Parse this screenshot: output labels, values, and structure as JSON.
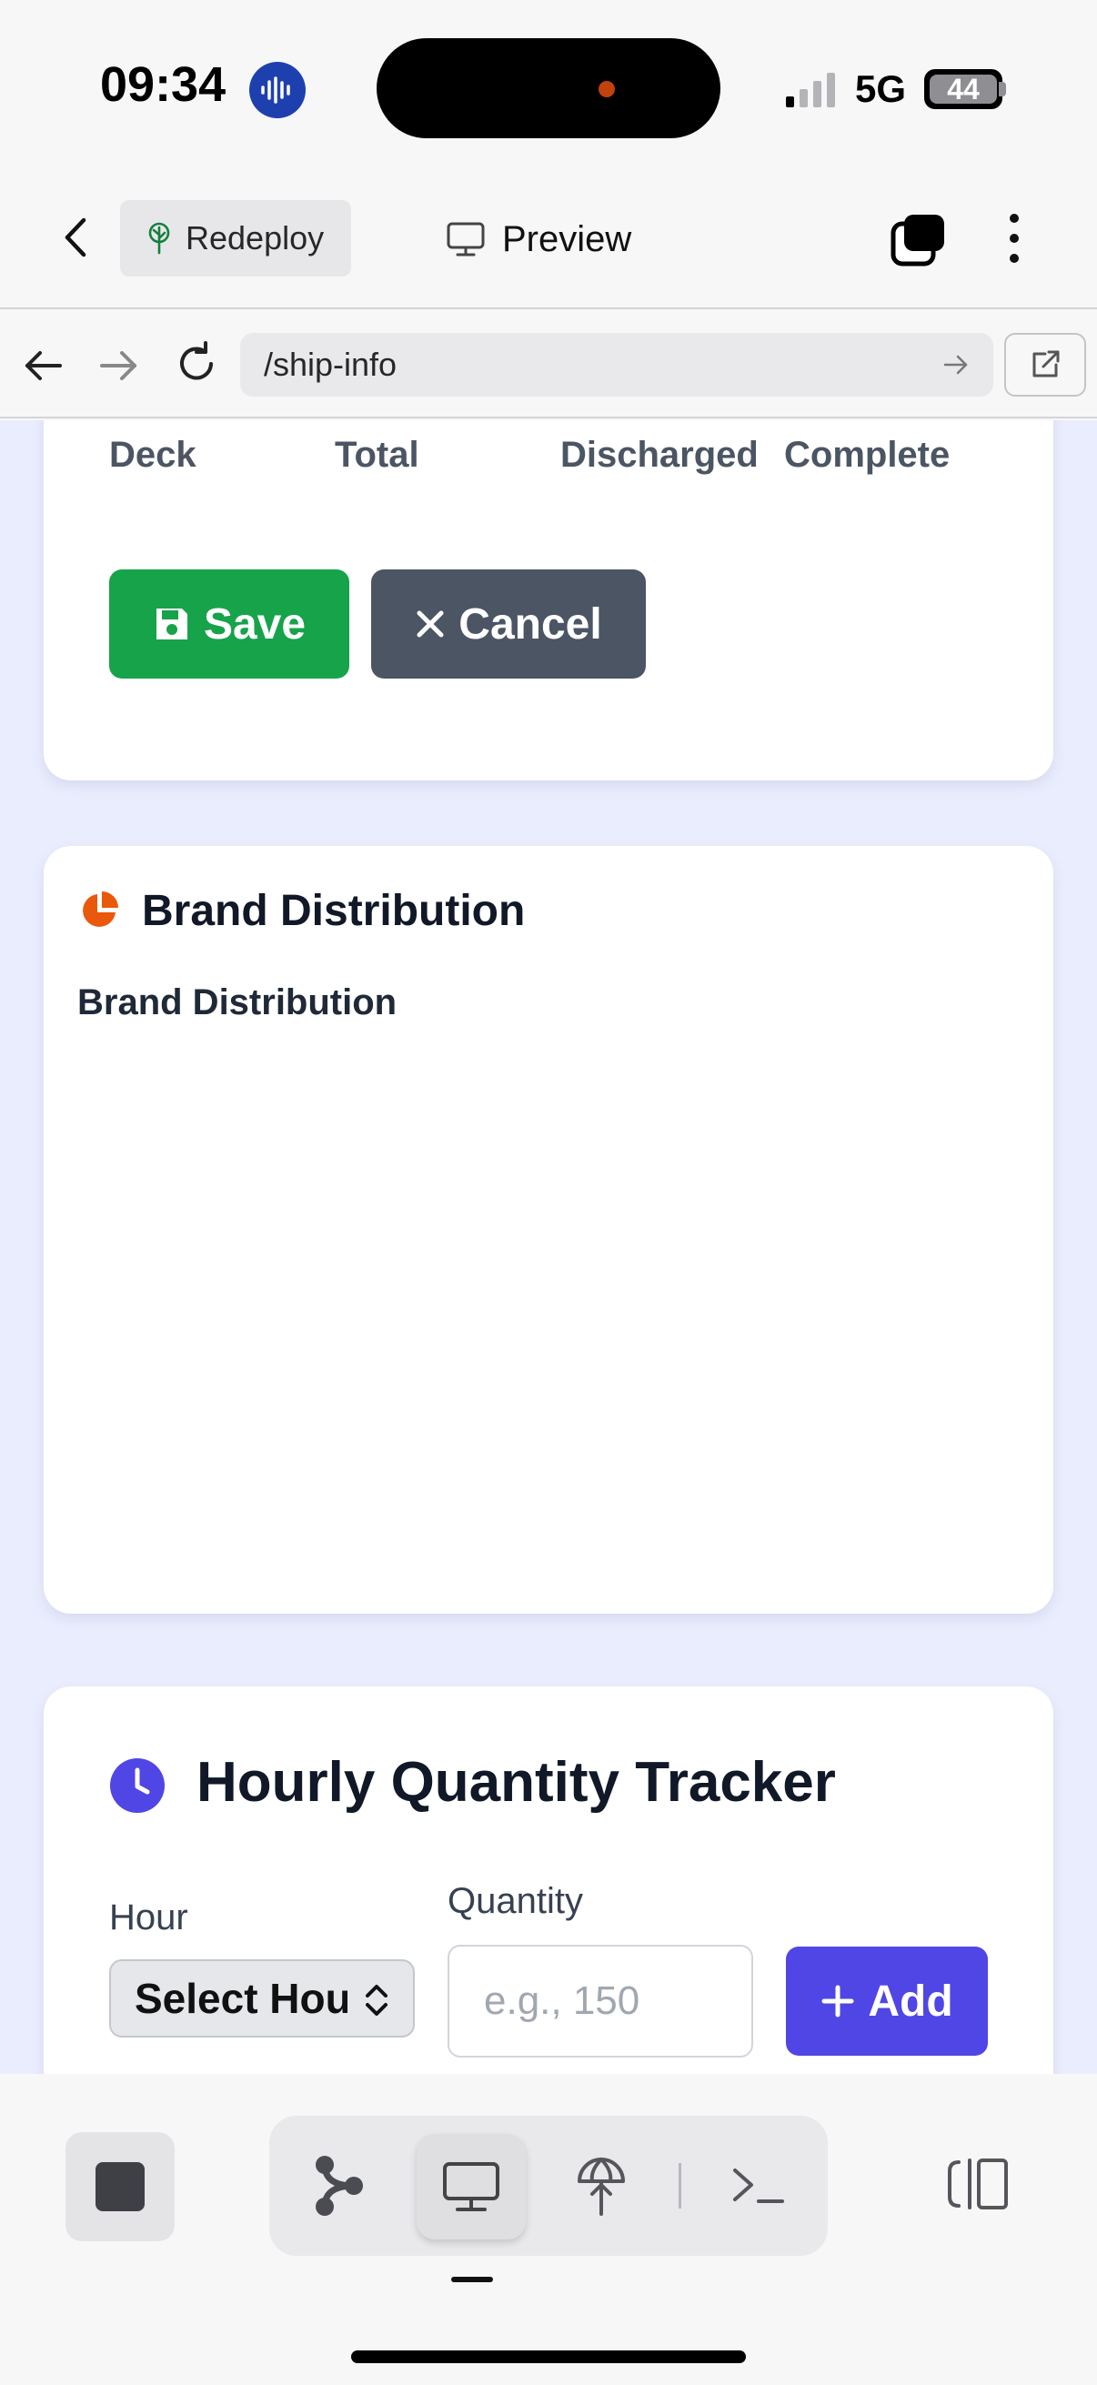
{
  "status_bar": {
    "time": "09:34",
    "network": "5G",
    "battery": "44"
  },
  "app_header": {
    "redeploy_label": "Redeploy",
    "preview_label": "Preview"
  },
  "browser": {
    "url": "/ship-info"
  },
  "table_card": {
    "columns": [
      "Deck",
      "Total",
      "Discharged",
      "Complete"
    ],
    "save_label": "Save",
    "cancel_label": "Cancel"
  },
  "brand_card": {
    "title": "Brand Distribution",
    "chart_title": "Brand Distribution"
  },
  "hourly_card": {
    "title": "Hourly Quantity Tracker",
    "hour_label": "Hour",
    "hour_value": "Select Hour",
    "quantity_label": "Quantity",
    "quantity_placeholder": "e.g., 150",
    "add_label": "Add"
  },
  "colors": {
    "save": "#16a34a",
    "cancel": "#4b5563",
    "add": "#4f46e5",
    "pie_icon": "#ea580c",
    "clock_icon": "#4f46e5",
    "page_bg": "#eaedfd"
  },
  "icons": [
    "siri-icon",
    "signal-icon",
    "back-icon",
    "tree-icon",
    "monitor-icon",
    "tabs-icon",
    "more-icon",
    "nav-back-icon",
    "nav-forward-icon",
    "reload-icon",
    "url-go-icon",
    "external-link-icon",
    "save-disk-icon",
    "close-x-icon",
    "pie-chart-icon",
    "clock-icon",
    "chevron-updown-icon",
    "plus-icon",
    "stop-icon",
    "branch-icon",
    "deploy-icon",
    "terminal-icon",
    "panel-icon"
  ]
}
